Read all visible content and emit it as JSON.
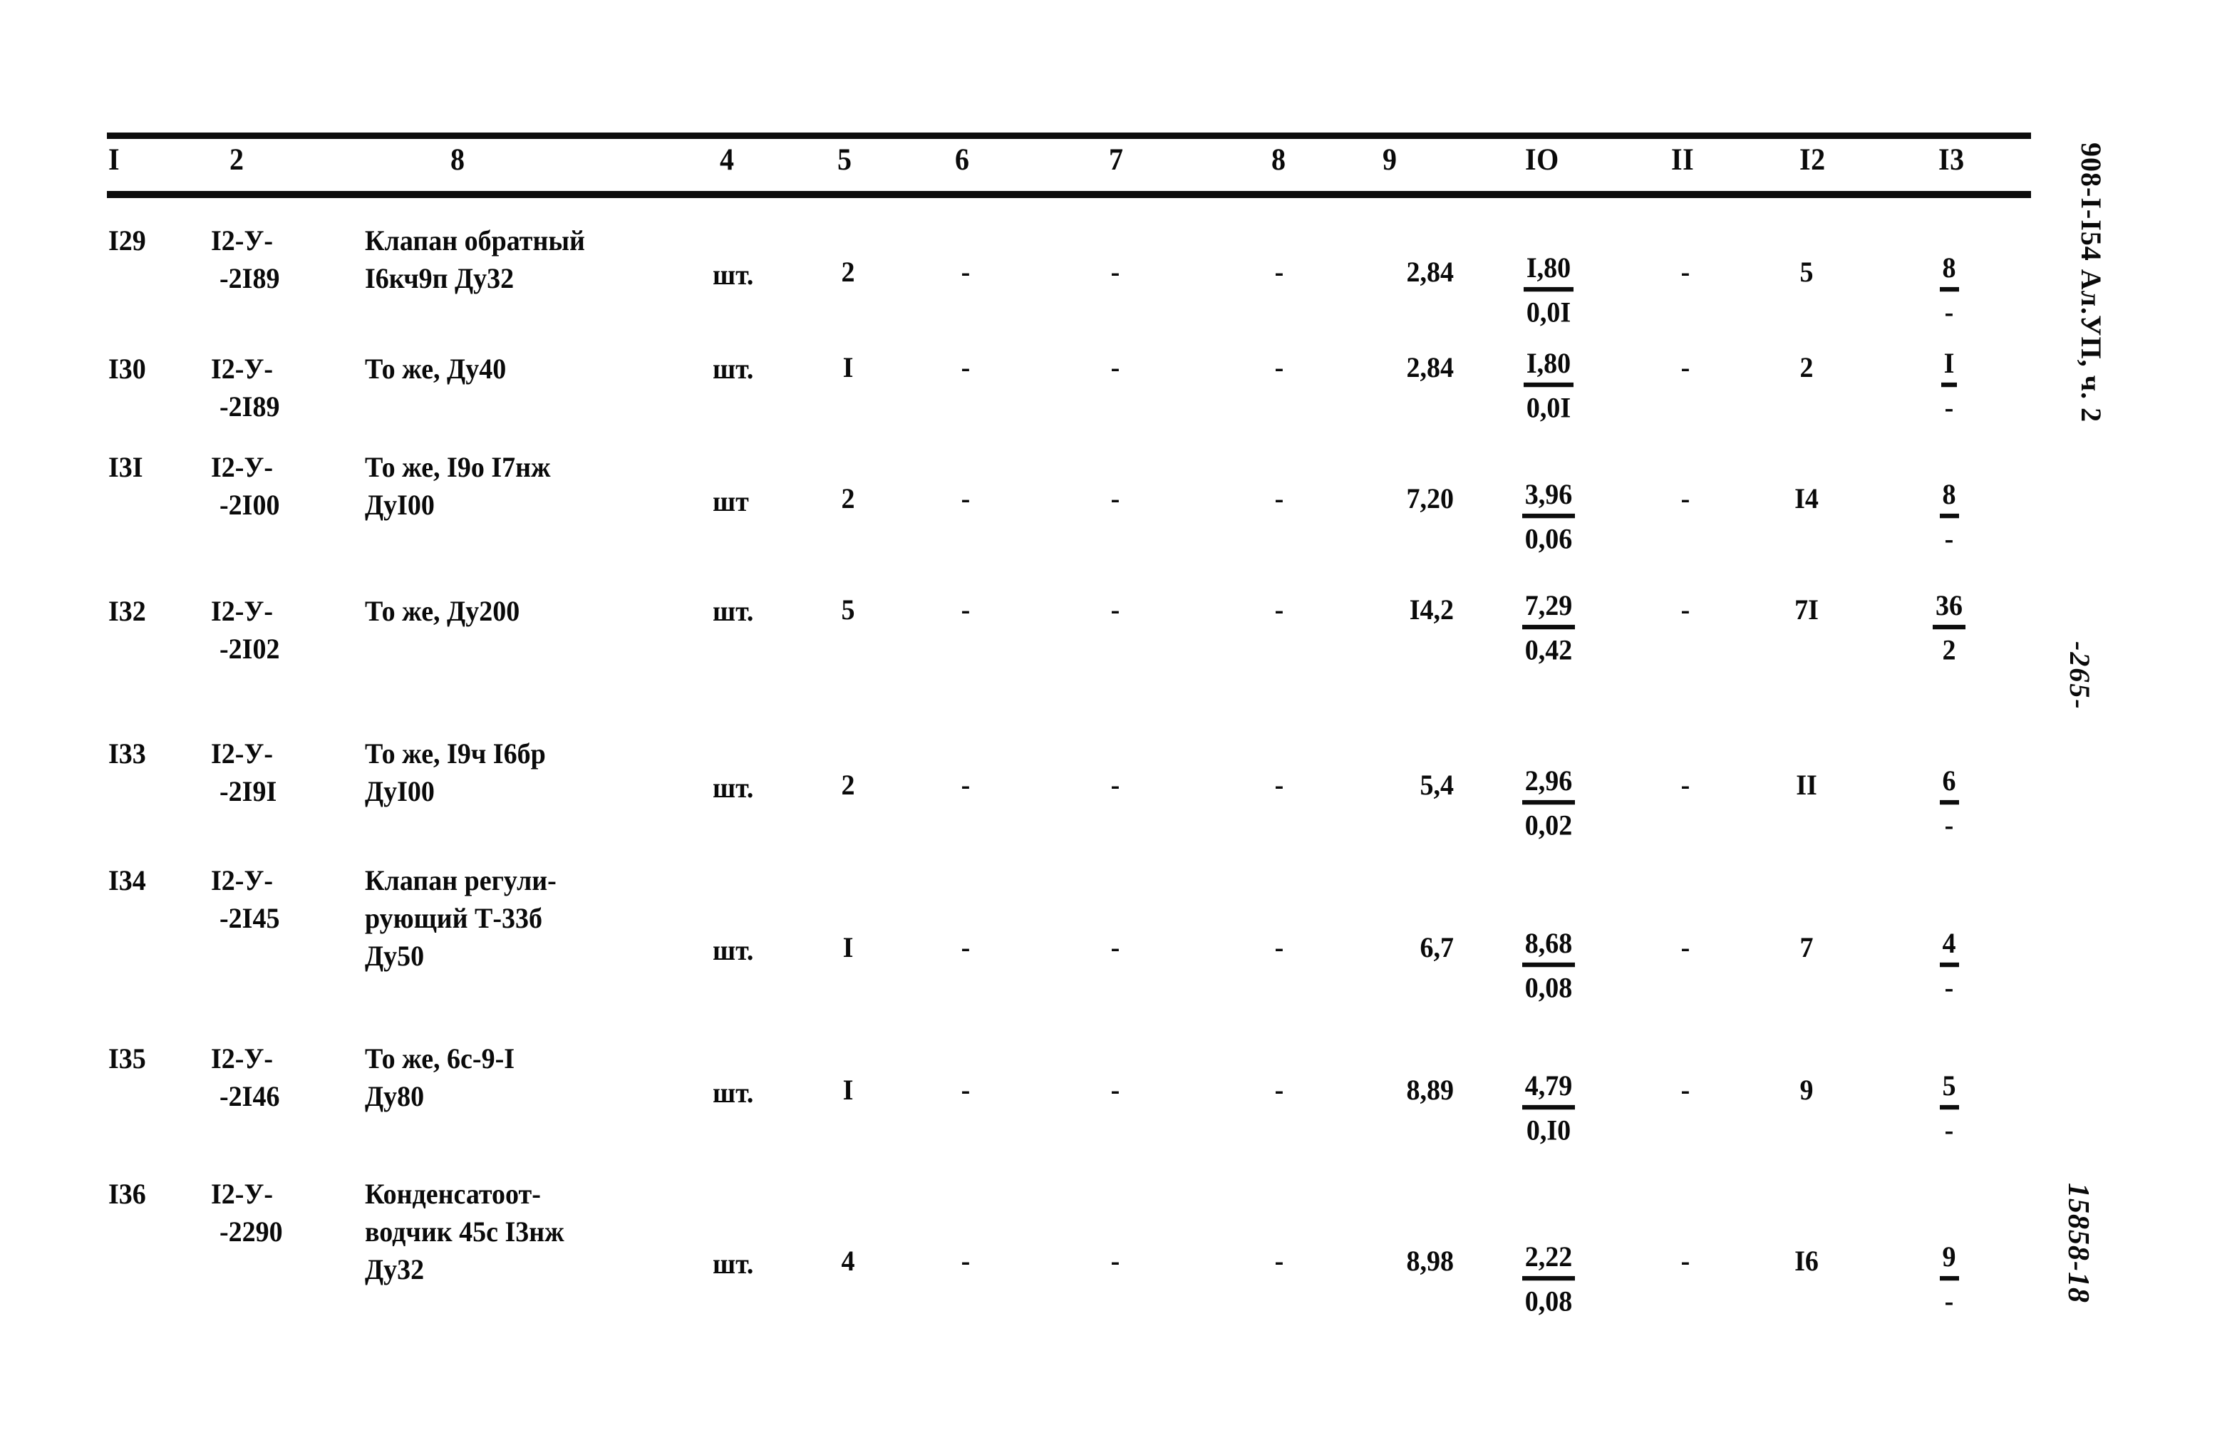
{
  "document": {
    "doc_code": "908-I-I54 Ал.УП, ч. 2",
    "page_number": "-265-",
    "archive_number": "15858-18"
  },
  "table": {
    "column_headers": [
      "I",
      "2",
      "8",
      "4",
      "5",
      "6",
      "7",
      "8",
      "9",
      "IO",
      "II",
      "I2",
      "I3"
    ],
    "rows": [
      {
        "c1": "I29",
        "c2_l1": "I2-У-",
        "c2_l2": "-2I89",
        "c3_l1": "Клапан обратный",
        "c3_l2": "I6кч9п Ду32",
        "c3_l3": "",
        "c4": "шт.",
        "c5": "2",
        "c6": "-",
        "c7": "-",
        "c8": "-",
        "c9": "2,84",
        "c10_num": "I,80",
        "c10_den": "0,0I",
        "c11": "-",
        "c12": "5",
        "c13_num": "8",
        "c13_den": "-"
      },
      {
        "c1": "I30",
        "c2_l1": "I2-У-",
        "c2_l2": "-2I89",
        "c3_l1": "То же, Ду40",
        "c3_l2": "",
        "c3_l3": "",
        "c4": "шт.",
        "c5": "I",
        "c6": "-",
        "c7": "-",
        "c8": "-",
        "c9": "2,84",
        "c10_num": "I,80",
        "c10_den": "0,0I",
        "c11": "-",
        "c12": "2",
        "c13_num": "I",
        "c13_den": "-"
      },
      {
        "c1": "I3I",
        "c2_l1": "I2-У-",
        "c2_l2": "-2I00",
        "c3_l1": "То же, I9о I7нж",
        "c3_l2": "ДуI00",
        "c3_l3": "",
        "c4": "шт",
        "c5": "2",
        "c6": "-",
        "c7": "-",
        "c8": "-",
        "c9": "7,20",
        "c10_num": "3,96",
        "c10_den": "0,06",
        "c11": "-",
        "c12": "I4",
        "c13_num": "8",
        "c13_den": "-"
      },
      {
        "c1": "I32",
        "c2_l1": "I2-У-",
        "c2_l2": "-2I02",
        "c3_l1": "То же, Ду200",
        "c3_l2": "",
        "c3_l3": "",
        "c4": "шт.",
        "c5": "5",
        "c6": "-",
        "c7": "-",
        "c8": "-",
        "c9": "I4,2",
        "c10_num": "7,29",
        "c10_den": "0,42",
        "c11": "-",
        "c12": "7I",
        "c13_num": "36",
        "c13_den": "2"
      },
      {
        "c1": "I33",
        "c2_l1": "I2-У-",
        "c2_l2": "-2I9I",
        "c3_l1": "То же, I9ч I6бр",
        "c3_l2": "ДуI00",
        "c3_l3": "",
        "c4": "шт.",
        "c5": "2",
        "c6": "-",
        "c7": "-",
        "c8": "-",
        "c9": "5,4",
        "c10_num": "2,96",
        "c10_den": "0,02",
        "c11": "-",
        "c12": "II",
        "c13_num": "6",
        "c13_den": "-"
      },
      {
        "c1": "I34",
        "c2_l1": "I2-У-",
        "c2_l2": "-2I45",
        "c3_l1": "Клапан регули-",
        "c3_l2": "рующий Т-33б",
        "c3_l3": "Ду50",
        "c4": "шт.",
        "c5": "I",
        "c6": "-",
        "c7": "-",
        "c8": "-",
        "c9": "6,7",
        "c10_num": "8,68",
        "c10_den": "0,08",
        "c11": "-",
        "c12": "7",
        "c13_num": "4",
        "c13_den": "-"
      },
      {
        "c1": "I35",
        "c2_l1": "I2-У-",
        "c2_l2": "-2I46",
        "c3_l1": "То же, 6с-9-I",
        "c3_l2": "Ду80",
        "c3_l3": "",
        "c4": "шт.",
        "c5": "I",
        "c6": "-",
        "c7": "-",
        "c8": "-",
        "c9": "8,89",
        "c10_num": "4,79",
        "c10_den": "0,I0",
        "c11": "-",
        "c12": "9",
        "c13_num": "5",
        "c13_den": "-"
      },
      {
        "c1": "I36",
        "c2_l1": "I2-У-",
        "c2_l2": "-2290",
        "c3_l1": "Конденсатоот-",
        "c3_l2": "водчик 45с I3нж",
        "c3_l3": "Ду32",
        "c4": "шт.",
        "c5": "4",
        "c6": "-",
        "c7": "-",
        "c8": "-",
        "c9": "8,98",
        "c10_num": "2,22",
        "c10_den": "0,08",
        "c11": "-",
        "c12": "I6",
        "c13_num": "9",
        "c13_den": "-"
      }
    ]
  }
}
